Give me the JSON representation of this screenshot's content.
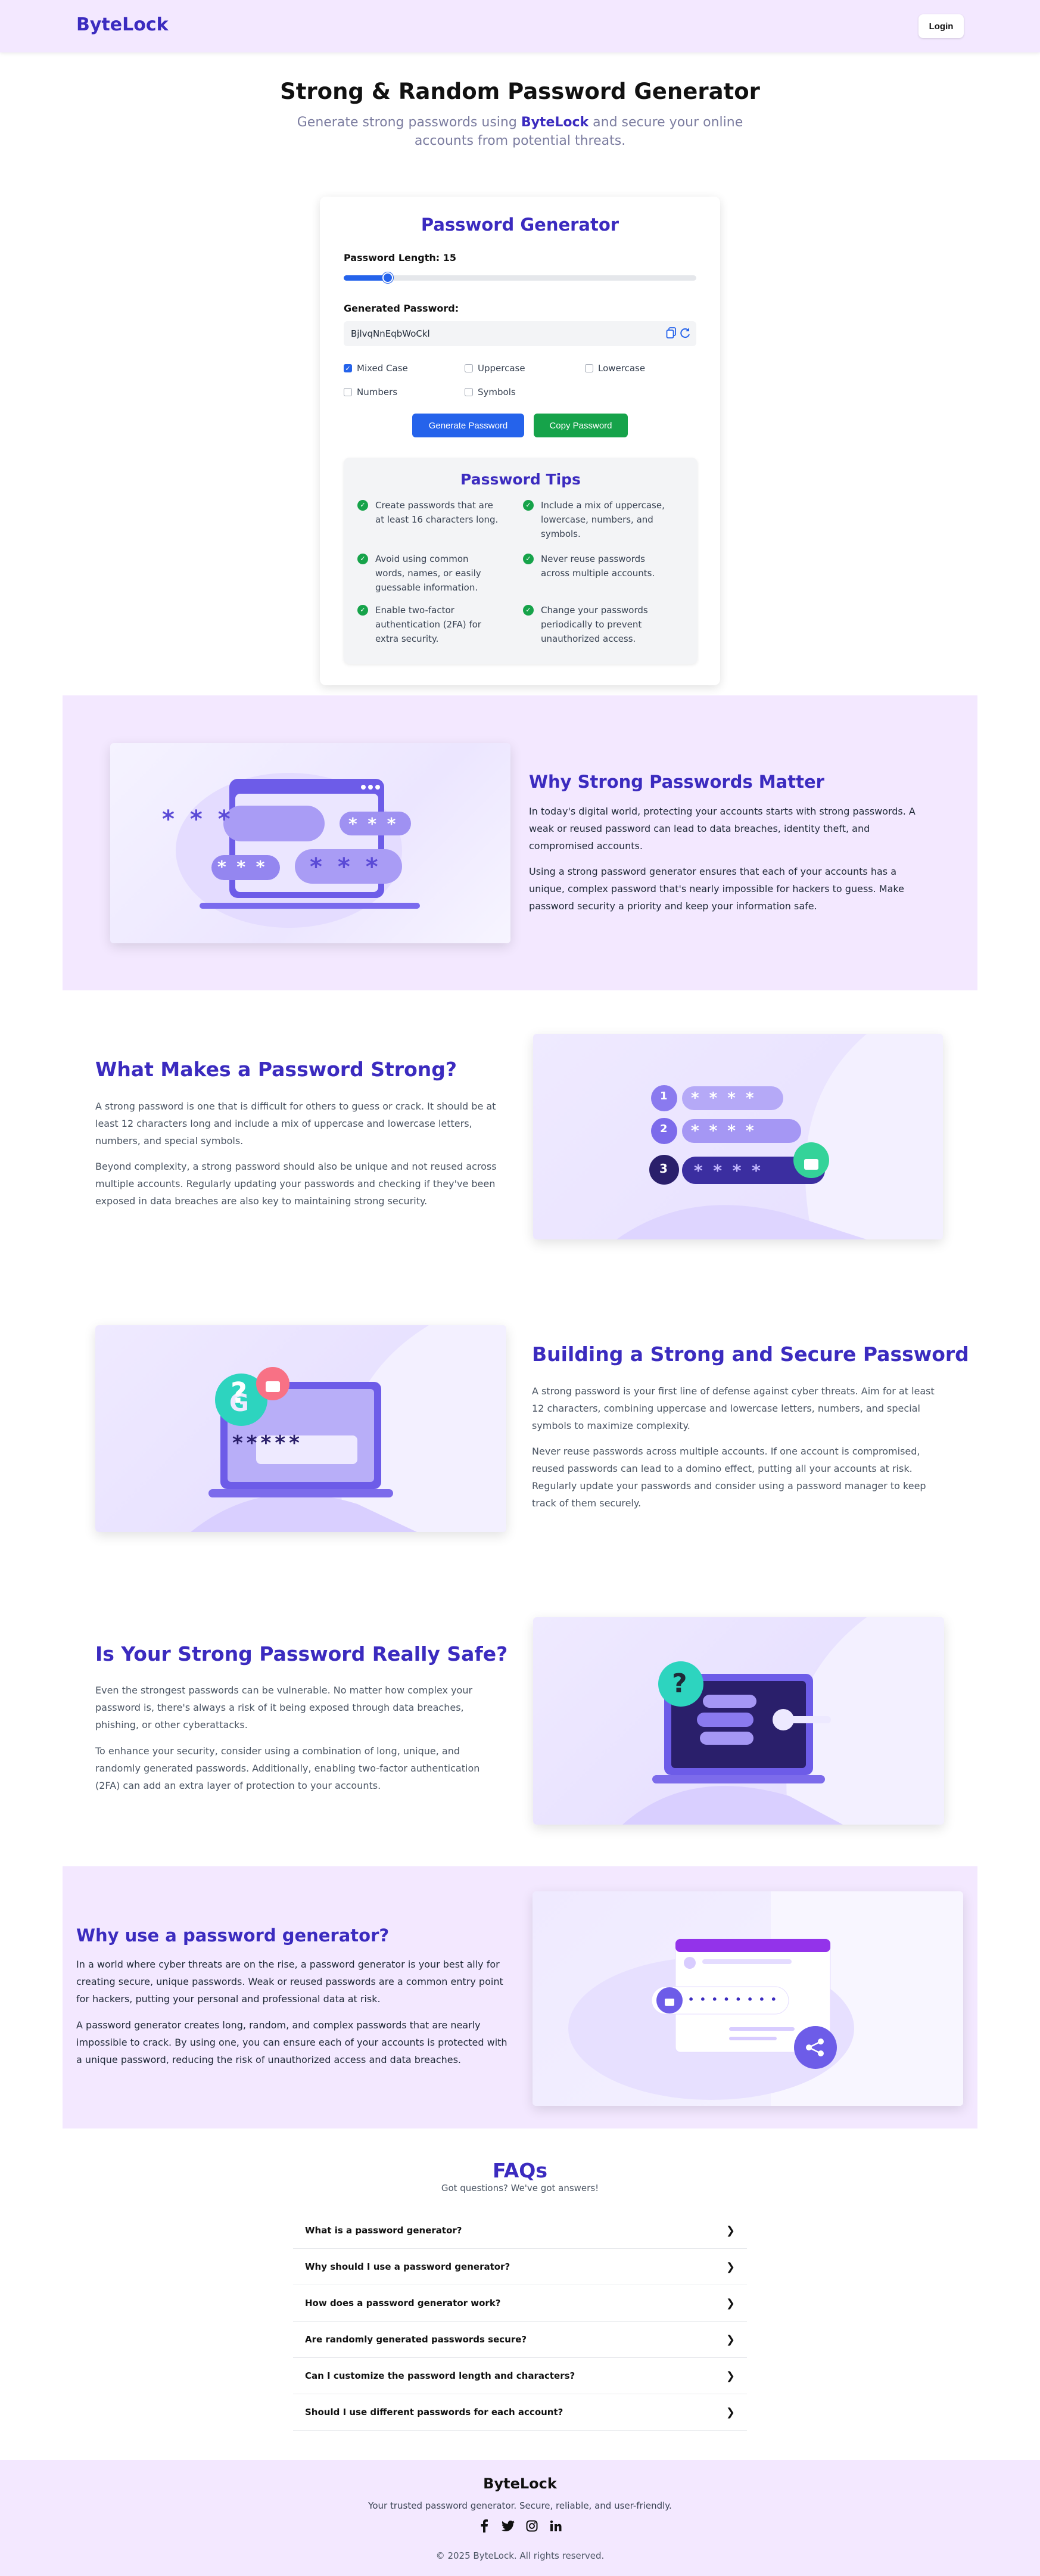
{
  "header": {
    "logo": "ByteLock",
    "login_label": "Login"
  },
  "hero": {
    "title": "Strong & Random Password Generator",
    "subtitle_pre": "Generate strong passwords using ",
    "subtitle_brand": "ByteLock",
    "subtitle_post": " and secure your online accounts from potential threats."
  },
  "generator": {
    "title": "Password Generator",
    "length_label": "Password Length: 15",
    "length_fraction": 0.125,
    "generated_label": "Generated Password:",
    "password": "BjlvqNnEqbWoCkl",
    "options": [
      {
        "label": "Mixed Case",
        "checked": true
      },
      {
        "label": "Uppercase",
        "checked": false
      },
      {
        "label": "Lowercase",
        "checked": false
      },
      {
        "label": "Numbers",
        "checked": false
      },
      {
        "label": "Symbols",
        "checked": false
      }
    ],
    "generate_label": "Generate Password",
    "copy_label": "Copy Password"
  },
  "tips": {
    "title": "Password Tips",
    "items": [
      "Create passwords that are at least 16 characters long.",
      "Include a mix of uppercase, lowercase, numbers, and symbols.",
      "Avoid using common words, names, or easily guessable information.",
      "Never reuse passwords across multiple accounts.",
      "Enable two-factor authentication (2FA) for extra security.",
      "Change your passwords periodically to prevent unauthorized access."
    ]
  },
  "sections": {
    "why": {
      "title": "Why Strong Passwords Matter",
      "p1": "In today's digital world, protecting your accounts starts with strong passwords. A weak or reused password can lead to data breaches, identity theft, and compromised accounts.",
      "p2": "Using a strong password generator ensures that each of your accounts has a unique, complex password that's nearly impossible for hackers to guess. Make password security a priority and keep your information safe."
    },
    "what": {
      "title": "What Makes a Password Strong?",
      "p1": "A strong password is one that is difficult for others to guess or crack. It should be at least 12 characters long and include a mix of uppercase and lowercase letters, numbers, and special symbols.",
      "p2": "Beyond complexity, a strong password should also be unique and not reused across multiple accounts. Regularly updating your passwords and checking if they've been exposed in data breaches are also key to maintaining strong security."
    },
    "building": {
      "title": "Building a Strong and Secure Password",
      "p1": "A strong password is your first line of defense against cyber threats. Aim for at least 12 characters, combining uppercase and lowercase letters, numbers, and special symbols to maximize complexity.",
      "p2": "Never reuse passwords across multiple accounts. If one account is compromised, reused passwords can lead to a domino effect, putting all your accounts at risk. Regularly update your passwords and consider using a password manager to keep track of them securely."
    },
    "safe": {
      "title": "Is Your Strong Password Really Safe?",
      "p1": "Even the strongest passwords can be vulnerable. No matter how complex your password is, there's always a risk of it being exposed through data breaches, phishing, or other cyberattacks.",
      "p2": "To enhance your security, consider using a combination of long, unique, and randomly generated passwords. Additionally, enabling two-factor authentication (2FA) can add an extra layer of protection to your accounts."
    },
    "usegen": {
      "title": "Why use a password generator?",
      "p1": "In a world where cyber threats are on the rise, a password generator is your best ally for creating secure, unique passwords. Weak or reused passwords are a common entry point for hackers, putting your personal and professional data at risk.",
      "p2": "A password generator creates long, random, and complex passwords that are nearly impossible to crack. By using one, you can ensure each of your accounts is protected with a unique password, reducing the risk of unauthorized access and data breaches."
    }
  },
  "illustrations": {
    "mask3": "* * *",
    "mask2": "* *",
    "mask4": "* * * *",
    "mask5": "*****",
    "g_letter": "G",
    "question": "?",
    "n1": "1",
    "n2": "2",
    "n3": "3",
    "dots": "• • • • • • • •"
  },
  "faq": {
    "title": "FAQs",
    "subtitle": "Got questions? We've got answers!",
    "items": [
      "What is a password generator?",
      "Why should I use a password generator?",
      "How does a password generator work?",
      "Are randomly generated passwords secure?",
      "Can I customize the password length and characters?",
      "Should I use different passwords for each account?"
    ]
  },
  "footer": {
    "brand": "ByteLock",
    "tagline": "Your trusted password generator. Secure, reliable, and user-friendly.",
    "social": [
      "facebook-icon",
      "twitter-icon",
      "instagram-icon",
      "linkedin-icon"
    ],
    "copyright": "© 2025 ByteLock. All rights reserved."
  },
  "colors": {
    "brand": "#3b2bbf",
    "accent_bg": "#f3e8ff",
    "primary": "#2563eb",
    "success": "#16a34a"
  }
}
